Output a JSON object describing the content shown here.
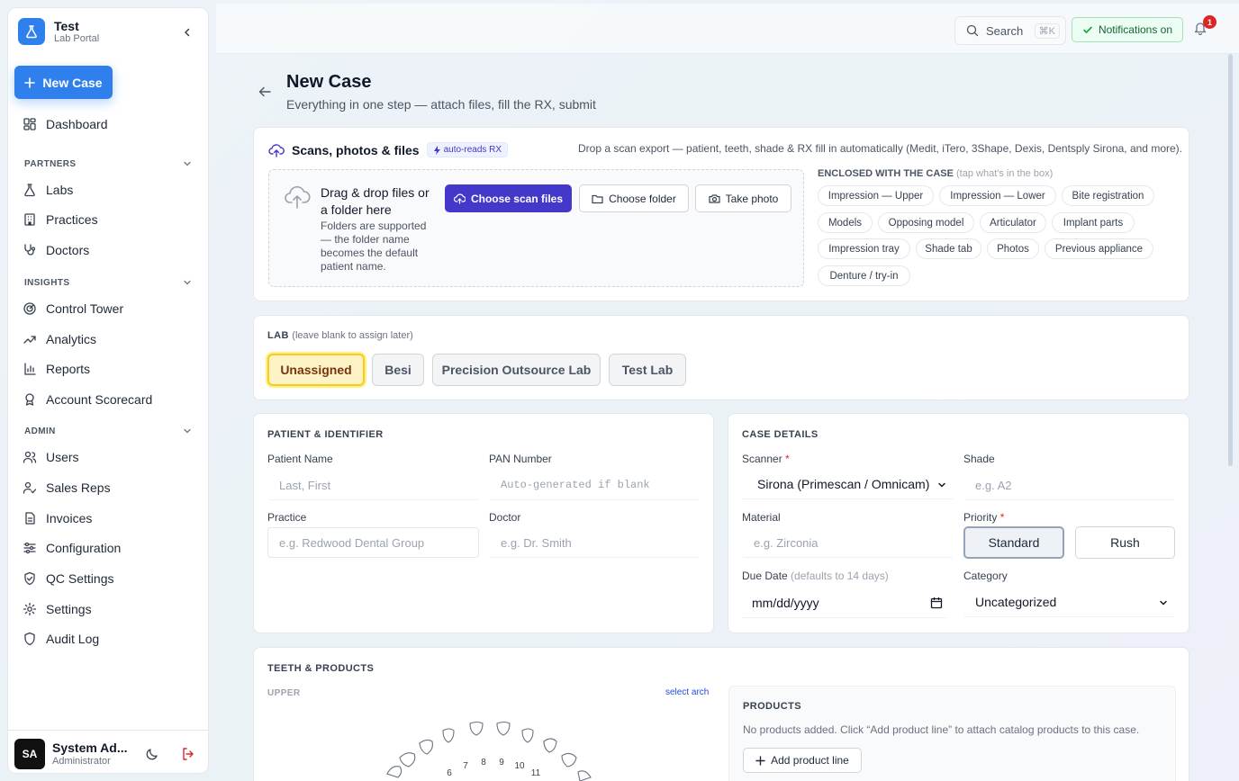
{
  "sidebar": {
    "brand_title": "Test",
    "brand_subtitle": "Lab Portal",
    "new_case_label": "New Case",
    "dashboard": "Dashboard",
    "partners_label": "PARTNERS",
    "partners": [
      "Labs",
      "Practices",
      "Doctors"
    ],
    "insights_label": "INSIGHTS",
    "insights": [
      "Control Tower",
      "Analytics",
      "Reports",
      "Account Scorecard"
    ],
    "admin_label": "ADMIN",
    "admin": [
      "Users",
      "Sales Reps",
      "Invoices",
      "Configuration",
      "QC Settings",
      "Settings",
      "Audit Log"
    ],
    "user": {
      "initials": "SA",
      "name": "System Ad...",
      "role": "Administrator"
    }
  },
  "topbar": {
    "search_label": "Search",
    "search_shortcut": "⌘K",
    "notifications_label": "Notifications on",
    "bell_count": "1"
  },
  "page": {
    "title": "New Case",
    "subtitle": "Everything in one step — attach files, fill the RX, submit"
  },
  "scans": {
    "title": "Scans, photos & files",
    "badge": "auto-reads RX",
    "hint": "Drop a scan export — patient, teeth, shade & RX fill in automatically (Medit, iTero, 3Shape, Dexis, Dentsply Sirona, and more).",
    "drop_title": "Drag & drop files or a folder here",
    "drop_desc": "Folders are supported — the folder name becomes the default patient name.",
    "choose_files": "Choose scan files",
    "choose_folder": "Choose folder",
    "take_photo": "Take photo",
    "enclosed_label": "ENCLOSED WITH THE CASE",
    "enclosed_hint": "(tap what's in the box)",
    "enclosed_items": [
      "Impression — Upper",
      "Impression — Lower",
      "Bite registration",
      "Models",
      "Opposing model",
      "Articulator",
      "Implant parts",
      "Impression tray",
      "Shade tab",
      "Photos",
      "Previous appliance",
      "Denture / try-in"
    ]
  },
  "lab": {
    "label": "LAB",
    "hint": "(leave blank to assign later)",
    "options": [
      "Unassigned",
      "Besi",
      "Precision Outsource Lab",
      "Test Lab"
    ],
    "selected": "Unassigned"
  },
  "patient": {
    "heading": "PATIENT & IDENTIFIER",
    "name_label": "Patient Name",
    "name_placeholder": "Last, First",
    "pan_label": "PAN Number",
    "pan_placeholder": "Auto-generated if blank",
    "practice_label": "Practice",
    "practice_placeholder": "e.g. Redwood Dental Group",
    "doctor_label": "Doctor",
    "doctor_placeholder": "e.g. Dr. Smith"
  },
  "case_details": {
    "heading": "CASE DETAILS",
    "scanner_label": "Scanner",
    "scanner_value": "Sirona (Primescan / Omnicam)",
    "shade_label": "Shade",
    "shade_placeholder": "e.g. A2",
    "material_label": "Material",
    "material_placeholder": "e.g. Zirconia",
    "priority_label": "Priority",
    "priority_options": [
      "Standard",
      "Rush"
    ],
    "priority_selected": "Standard",
    "due_label": "Due Date",
    "due_hint": "(defaults to 14 days)",
    "due_value": "mm/dd/yyyy",
    "category_label": "Category",
    "category_value": "Uncategorized"
  },
  "teeth": {
    "heading": "TEETH & PRODUCTS",
    "upper_label": "UPPER",
    "select_arch": "select arch",
    "tooth_numbers": [
      "6",
      "7",
      "8",
      "9",
      "10",
      "11"
    ]
  },
  "products": {
    "heading": "PRODUCTS",
    "empty_text": "No products added. Click “Add product line” to attach catalog products to this case.",
    "add_line": "Add product line"
  },
  "colors": {
    "primary": "#2f80ed",
    "indigo": "#4338ca",
    "selected_lab_bg": "#fef3c7",
    "selected_lab_border": "#facc15",
    "notif_green": "#166534",
    "badge_red": "#dc2626"
  }
}
